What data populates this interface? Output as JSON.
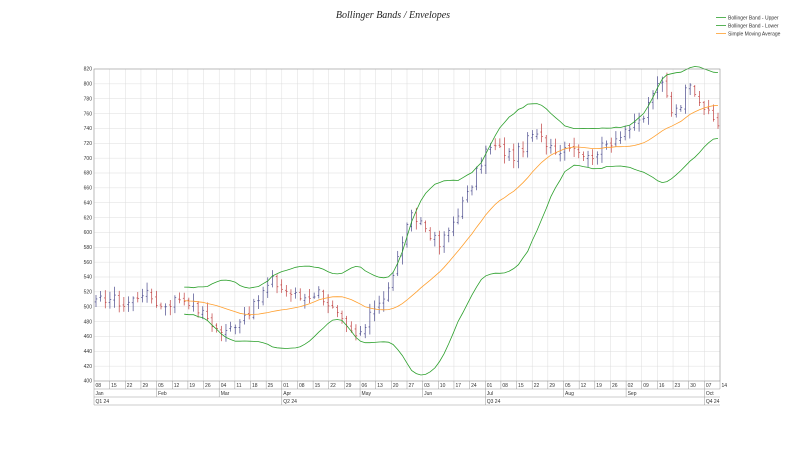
{
  "chart_data": {
    "type": "ohlc",
    "title": "Bollinger Bands / Envelopes",
    "xlabel": "",
    "ylabel": "",
    "ylim": [
      400,
      820
    ],
    "y_ticks": [
      400,
      420,
      440,
      460,
      480,
      500,
      520,
      540,
      560,
      580,
      600,
      620,
      640,
      660,
      680,
      700,
      720,
      740,
      760,
      780,
      800,
      820
    ],
    "grid": true,
    "legend_position": "top-right",
    "legend": [
      {
        "name": "Bollinger Band - Upper",
        "color": "#2ca02c"
      },
      {
        "name": "Bollinger Band - Lower",
        "color": "#2ca02c"
      },
      {
        "name": "Simple Moving Average",
        "color": "#ff9f2e"
      }
    ],
    "colors": {
      "up": "#4a4a8c",
      "down": "#c04040",
      "band": "#2ca02c",
      "sma": "#ff9f2e",
      "grid": "#dddddd"
    },
    "x_axis": {
      "day_ticks": [
        "08",
        "15",
        "22",
        "29",
        "05",
        "12",
        "19",
        "26",
        "04",
        "11",
        "18",
        "25",
        "01",
        "08",
        "15",
        "22",
        "29",
        "06",
        "13",
        "20",
        "27",
        "03",
        "10",
        "17",
        "24",
        "01",
        "08",
        "15",
        "22",
        "29",
        "05",
        "12",
        "19",
        "26",
        "02",
        "09",
        "16",
        "23",
        "30",
        "07",
        "14"
      ],
      "months": [
        {
          "label": "Jan",
          "index": 0
        },
        {
          "label": "Feb",
          "index": 4
        },
        {
          "label": "Mar",
          "index": 8
        },
        {
          "label": "Apr",
          "index": 12
        },
        {
          "label": "May",
          "index": 17
        },
        {
          "label": "Jun",
          "index": 21
        },
        {
          "label": "Jul",
          "index": 25
        },
        {
          "label": "Aug",
          "index": 30
        },
        {
          "label": "Sep",
          "index": 34
        },
        {
          "label": "Oct",
          "index": 39
        }
      ],
      "quarters": [
        {
          "label": "Q1 24",
          "index": 0
        },
        {
          "label": "Q2 24",
          "index": 12
        },
        {
          "label": "Q3 24",
          "index": 25
        },
        {
          "label": "Q4 24",
          "index": 39
        }
      ]
    },
    "price_anchors": [
      [
        0,
        505
      ],
      [
        2,
        512
      ],
      [
        4,
        510
      ],
      [
        6,
        502
      ],
      [
        8,
        510
      ],
      [
        10,
        520
      ],
      [
        12,
        512
      ],
      [
        14,
        500
      ],
      [
        16,
        506
      ],
      [
        18,
        512
      ],
      [
        20,
        508
      ],
      [
        22,
        496
      ],
      [
        24,
        485
      ],
      [
        26,
        470
      ],
      [
        28,
        465
      ],
      [
        30,
        478
      ],
      [
        32,
        490
      ],
      [
        34,
        500
      ],
      [
        36,
        520
      ],
      [
        38,
        535
      ],
      [
        40,
        525
      ],
      [
        42,
        518
      ],
      [
        44,
        512
      ],
      [
        46,
        515
      ],
      [
        48,
        520
      ],
      [
        50,
        505
      ],
      [
        52,
        488
      ],
      [
        54,
        468
      ],
      [
        56,
        458
      ],
      [
        58,
        472
      ],
      [
        60,
        500
      ],
      [
        62,
        515
      ],
      [
        64,
        540
      ],
      [
        66,
        590
      ],
      [
        68,
        620
      ],
      [
        70,
        615
      ],
      [
        72,
        598
      ],
      [
        74,
        582
      ],
      [
        76,
        602
      ],
      [
        78,
        628
      ],
      [
        80,
        650
      ],
      [
        82,
        680
      ],
      [
        84,
        710
      ],
      [
        86,
        715
      ],
      [
        88,
        708
      ],
      [
        90,
        702
      ],
      [
        92,
        715
      ],
      [
        94,
        732
      ],
      [
        96,
        725
      ],
      [
        98,
        718
      ],
      [
        100,
        710
      ],
      [
        102,
        720
      ],
      [
        104,
        712
      ],
      [
        106,
        700
      ],
      [
        108,
        710
      ],
      [
        110,
        718
      ],
      [
        112,
        728
      ],
      [
        114,
        740
      ],
      [
        116,
        742
      ],
      [
        118,
        755
      ],
      [
        120,
        790
      ],
      [
        122,
        800
      ],
      [
        124,
        765
      ],
      [
        126,
        775
      ],
      [
        128,
        805
      ],
      [
        130,
        780
      ],
      [
        132,
        758
      ],
      [
        134,
        745
      ]
    ],
    "bar_count": 135,
    "band_period": 20,
    "band_width_sd": 2
  }
}
